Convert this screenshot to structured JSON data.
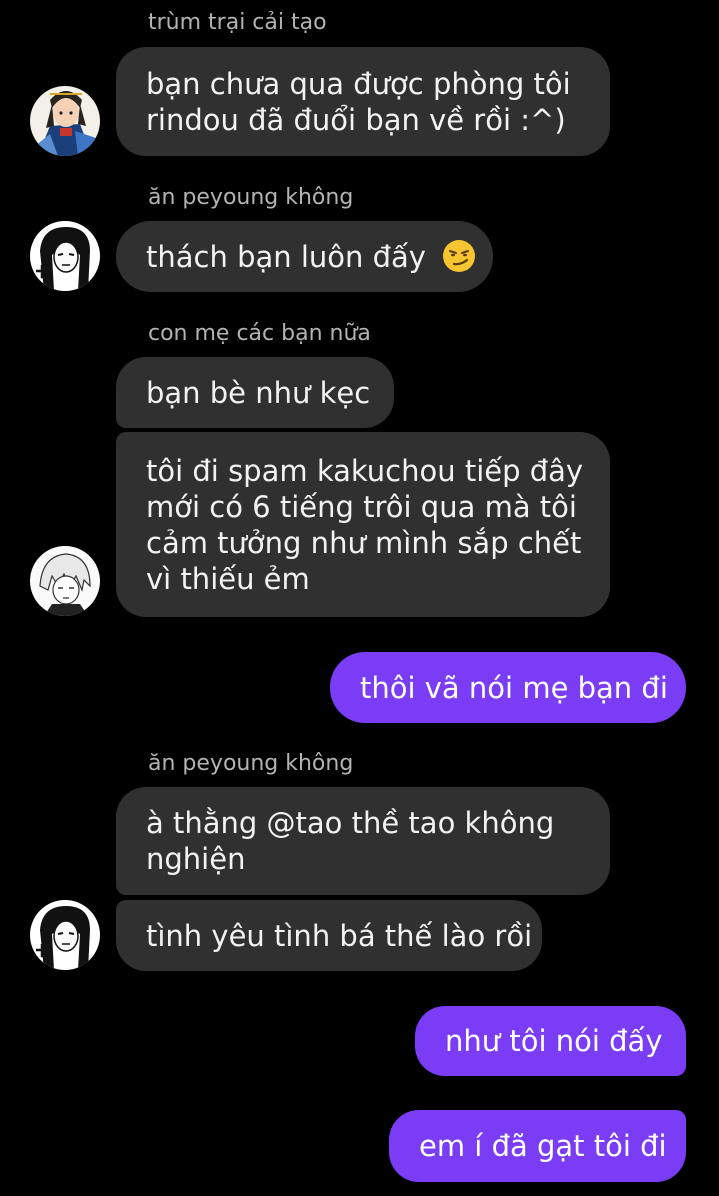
{
  "colors": {
    "background": "#000000",
    "incoming_bubble": "#303030",
    "outgoing_bubble": "#7b3cf6",
    "sender_text": "#b3b3b3"
  },
  "messages": {
    "sender_1": "trùm trại cải tạo",
    "msg_1_line_1": "bạn chưa qua được phòng tôi",
    "msg_1_line_2": "rindou đã đuổi bạn về rồi :^)",
    "sender_2": "ăn peyoung không",
    "msg_2_text": "thách bạn luôn đấy",
    "msg_2_emoji": "smirking-face-emoji",
    "sender_3": "con mẹ các bạn nữa",
    "msg_3_text": "bạn bè như kẹc",
    "msg_4_line_1": "tôi đi spam kakuchou tiếp đây",
    "msg_4_line_2": "mới có 6 tiếng trôi qua mà tôi",
    "msg_4_line_3": "cảm tưởng như mình sắp chết",
    "msg_4_line_4": "vì thiếu ẻm",
    "msg_5_out": "thôi vã nói mẹ bạn đi",
    "sender_4": "ăn peyoung không",
    "msg_6_line_1": "à thằng @tao thề tao không",
    "msg_6_line_2": "nghiện",
    "msg_7_text": "tình yêu tình bá thế lào rồi",
    "msg_8_out": "như tôi nói đấy",
    "msg_9_out": "em í đã gạt tôi đi"
  },
  "avatars": {
    "avatar_1": "avatar-illustrated-character-color",
    "avatar_2": "avatar-manga-long-hair",
    "avatar_3": "avatar-manga-light-hair",
    "avatar_4": "avatar-manga-long-hair"
  }
}
